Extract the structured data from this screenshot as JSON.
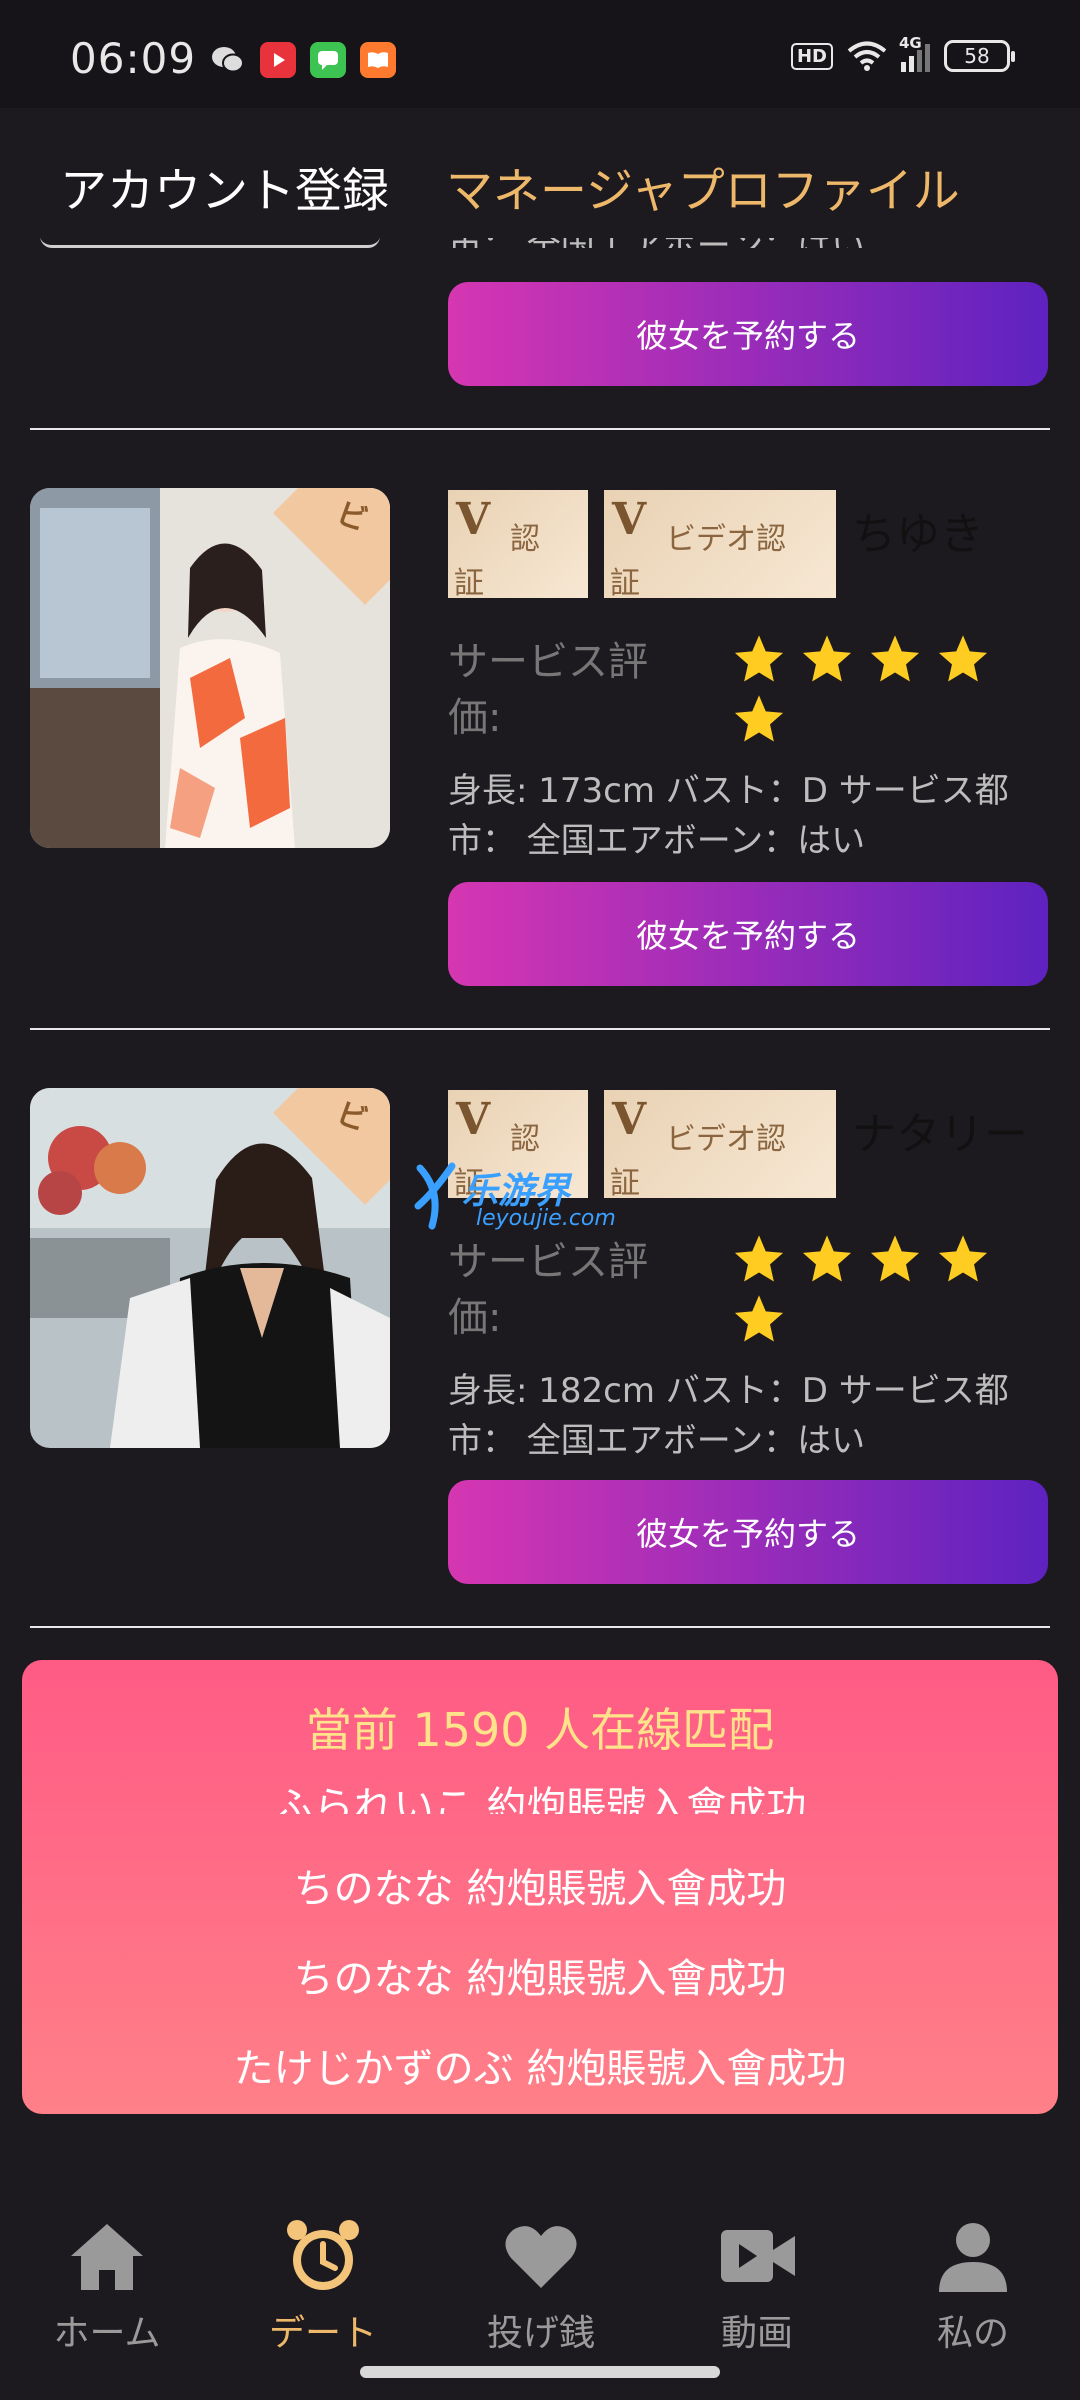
{
  "status_bar": {
    "time": "06:09",
    "hd": "HD",
    "network": "4G",
    "battery": "58"
  },
  "header": {
    "tabs": [
      {
        "label": "アカウント登録",
        "active": true
      },
      {
        "label": "マネージャプロファイル",
        "active": false
      }
    ]
  },
  "partial_card": {
    "desc_fragment": "市：  全国エアボーン：はい",
    "book_label": "彼女を予約する"
  },
  "cards": [
    {
      "name": "ちゆき",
      "badge1": {
        "mark": "V",
        "text1": "認",
        "text2": "証"
      },
      "badge2": {
        "mark": "V",
        "text1": "ビデオ認",
        "text2": "証"
      },
      "photo_ribbon": "ビ",
      "rating_label": "サービス評価:",
      "stars": 5,
      "description": "身長: 173cm バスト：D サービス都市：  全国エアボーン：はい",
      "book_label": "彼女を予約する"
    },
    {
      "name": "ナタリー",
      "badge1": {
        "mark": "V",
        "text1": "認",
        "text2": "証"
      },
      "badge2": {
        "mark": "V",
        "text1": "ビデオ認",
        "text2": "証"
      },
      "photo_ribbon": "ビ",
      "rating_label": "サービス評価:",
      "stars": 5,
      "description": "身長: 182cm バスト：D サービス都市：  全国エアボーン：はい",
      "book_label": "彼女を予約する"
    }
  ],
  "watermark": {
    "text": "乐游界",
    "sub": "leyoujie.com"
  },
  "matching": {
    "title": "當前 1590 人在線匹配",
    "lines": [
      "ふられいこ 約炮賬號入會成功",
      "ちのなな 約炮賬號入會成功",
      "ちのなな 約炮賬號入會成功",
      "たけじかずのぶ 約炮賬號入會成功"
    ]
  },
  "bottom_nav": [
    {
      "label": "ホーム",
      "icon": "home-icon",
      "active": false
    },
    {
      "label": "デート",
      "icon": "alarm-clock-icon",
      "active": true
    },
    {
      "label": "投げ銭",
      "icon": "heart-icon",
      "active": false
    },
    {
      "label": "動画",
      "icon": "video-camera-icon",
      "active": false
    },
    {
      "label": "私の",
      "icon": "person-icon",
      "active": false
    }
  ],
  "colors": {
    "background": "#1d1a1f",
    "accent_gold": "#eeb86a",
    "button_gradient_start": "#d636b2",
    "button_gradient_end": "#5e22c0",
    "star": "#ffcc22",
    "match_panel": "#ff6a86"
  }
}
